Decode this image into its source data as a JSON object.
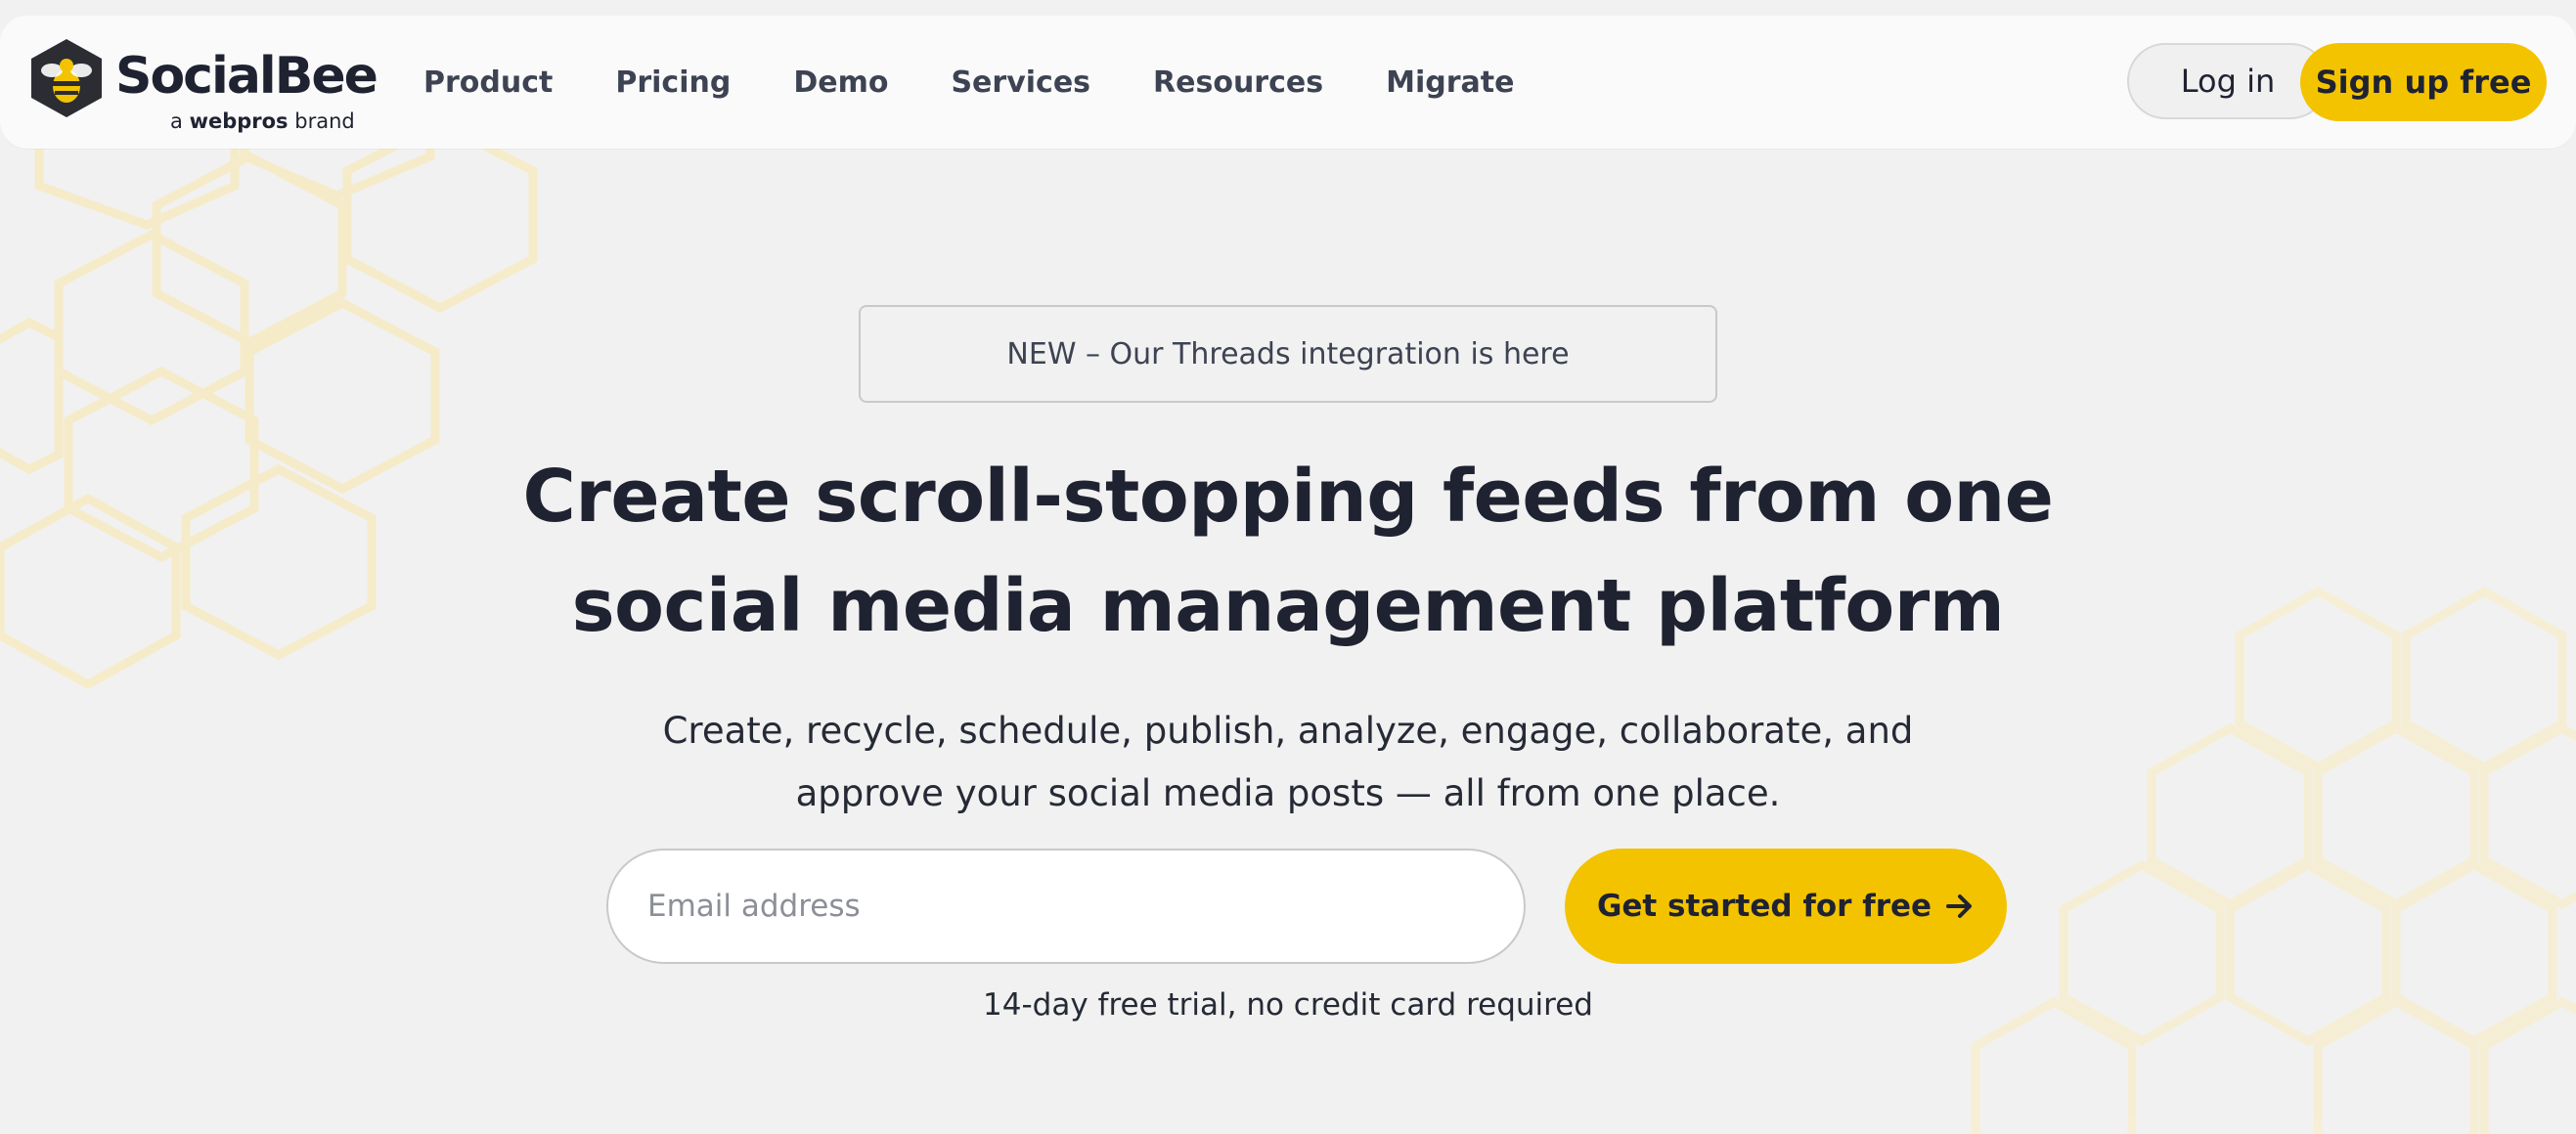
{
  "header": {
    "logo": {
      "name": "SocialBee",
      "sub_prefix": "a",
      "sub_brand": "webpros",
      "sub_suffix": "brand",
      "icon": "bee-hexagon-icon"
    },
    "nav": [
      "Product",
      "Pricing",
      "Demo",
      "Services",
      "Resources",
      "Migrate"
    ],
    "login_label": "Log in",
    "signup_label": "Sign up free"
  },
  "hero": {
    "badge": "NEW – Our Threads integration is here",
    "headline_line1": "Create scroll-stopping feeds from one",
    "headline_line2": "social media management platform",
    "subhead_line1": "Create, recycle, schedule, publish, analyze, engage, collaborate, and",
    "subhead_line2": "approve your social media posts — all from one place.",
    "email_placeholder": "Email address",
    "email_value": "",
    "cta_label": "Get started for free",
    "cta_icon": "arrow-right-icon",
    "trial_note": "14-day free trial, no credit card required"
  },
  "colors": {
    "accent": "#f3c300",
    "text": "#1f2231",
    "page_bg": "#f1f1f1",
    "hex_pattern": "#f7ecc6"
  }
}
